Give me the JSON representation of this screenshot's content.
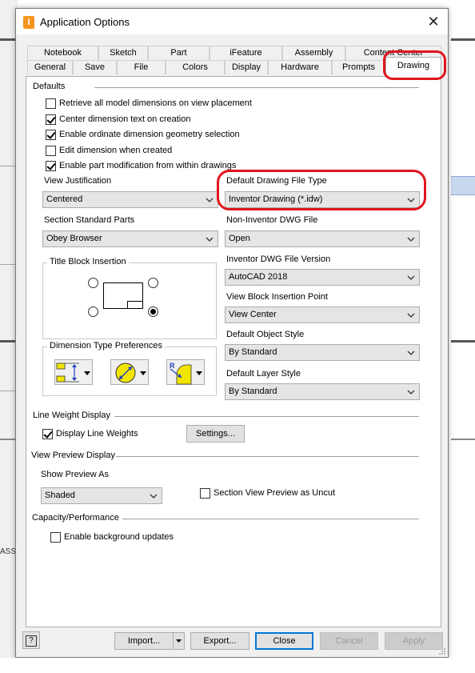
{
  "window": {
    "title": "Application Options",
    "close_glyph": "✕",
    "icon_letter": "I"
  },
  "tabs_row1": [
    "Notebook",
    "Sketch",
    "Part",
    "iFeature",
    "Assembly",
    "Content Center"
  ],
  "tabs_row2": [
    "General",
    "Save",
    "File",
    "Colors",
    "Display",
    "Hardware",
    "Prompts"
  ],
  "active_tab": "Drawing",
  "defaults": {
    "heading": "Defaults",
    "checkboxes": [
      {
        "label": "Retrieve all model dimensions on view placement",
        "checked": false
      },
      {
        "label": "Center dimension text on creation",
        "checked": true
      },
      {
        "label": "Enable ordinate dimension geometry selection",
        "checked": true
      },
      {
        "label": "Edit dimension when created",
        "checked": false
      },
      {
        "label": "Enable part modification from within drawings",
        "checked": true
      }
    ]
  },
  "view_justification": {
    "label": "View Justification",
    "value": "Centered"
  },
  "section_standard_parts": {
    "label": "Section Standard Parts",
    "value": "Obey Browser"
  },
  "title_block_insertion": {
    "label": "Title Block Insertion",
    "selected": "bottom-right"
  },
  "dimension_type_preferences": {
    "label": "Dimension Type Preferences",
    "radius_glyph": "R"
  },
  "default_drawing_file_type": {
    "label": "Default Drawing File Type",
    "value": "Inventor Drawing (*.idw)"
  },
  "non_inventor_dwg_file": {
    "label": "Non-Inventor DWG File",
    "value": "Open"
  },
  "inventor_dwg_file_version": {
    "label": "Inventor DWG File Version",
    "value": "AutoCAD 2018"
  },
  "view_block_insertion_point": {
    "label": "View Block Insertion Point",
    "value": "View Center"
  },
  "default_object_style": {
    "label": "Default Object Style",
    "value": "By Standard"
  },
  "default_layer_style": {
    "label": "Default Layer Style",
    "value": "By Standard"
  },
  "line_weight": {
    "heading": "Line Weight Display",
    "display_line_weights": {
      "label": "Display Line Weights",
      "checked": true
    },
    "settings_button": "Settings..."
  },
  "view_preview": {
    "heading": "View Preview Display",
    "show_preview_as_label": "Show Preview As",
    "show_preview_as_value": "Shaded",
    "section_uncut": {
      "label": "Section View Preview as Uncut",
      "checked": false
    }
  },
  "capacity": {
    "heading": "Capacity/Performance",
    "background_updates": {
      "label": "Enable background updates",
      "checked": false
    }
  },
  "footer": {
    "help_glyph": "?",
    "import": "Import...",
    "export": "Export...",
    "close": "Close",
    "cancel": "Cancel",
    "apply": "Apply"
  },
  "background_app": {
    "left_label": "ASS"
  },
  "colors": {
    "highlight": "#e0151d",
    "accent": "#0078d7",
    "dim_icon_yellow": "#f2e600",
    "dim_icon_blue": "#1f3fbf"
  }
}
